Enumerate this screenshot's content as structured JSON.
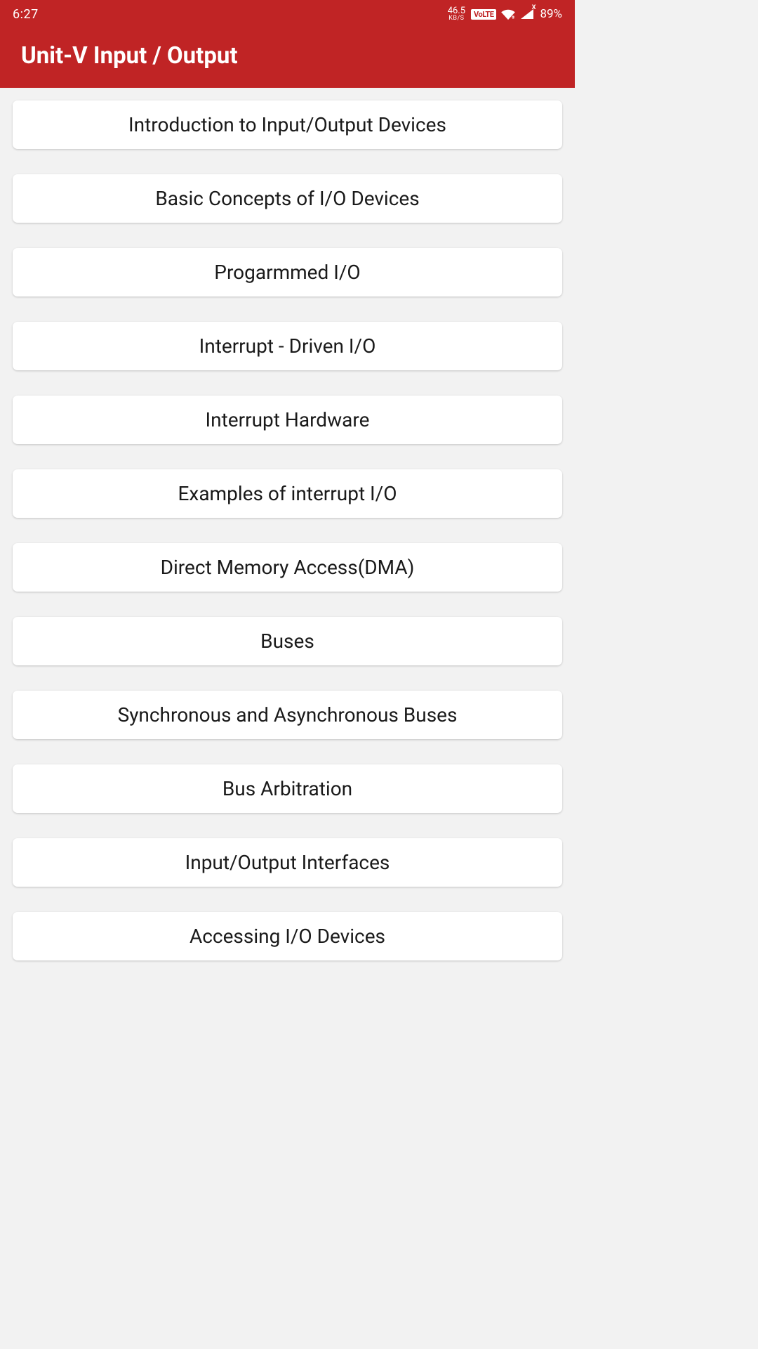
{
  "statusbar": {
    "time": "6:27",
    "net_speed_value": "46.5",
    "net_speed_unit": "KB/S",
    "volte": "VoLTE",
    "signal_marker": "X",
    "battery": "89%"
  },
  "appbar": {
    "title": "Unit-V Input / Output"
  },
  "items": [
    {
      "label": "Introduction to Input/Output Devices"
    },
    {
      "label": "Basic Concepts of I/O Devices"
    },
    {
      "label": "Progarmmed I/O"
    },
    {
      "label": "Interrupt - Driven I/O"
    },
    {
      "label": "Interrupt Hardware"
    },
    {
      "label": "Examples of interrupt I/O"
    },
    {
      "label": "Direct Memory Access(DMA)"
    },
    {
      "label": "Buses"
    },
    {
      "label": "Synchronous and Asynchronous Buses"
    },
    {
      "label": "Bus Arbitration"
    },
    {
      "label": "Input/Output Interfaces"
    },
    {
      "label": "Accessing I/O Devices"
    }
  ]
}
